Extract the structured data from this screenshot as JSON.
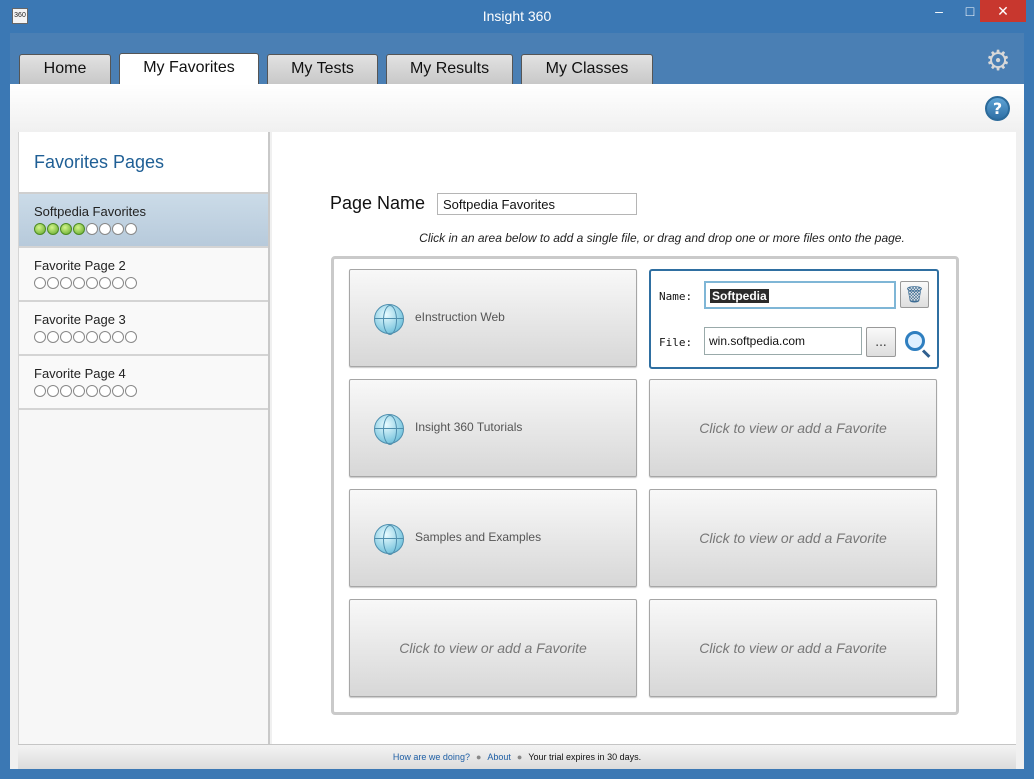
{
  "window": {
    "title": "Insight 360",
    "icon_label": "360",
    "minimize": "–",
    "maximize": "□",
    "close": "✕"
  },
  "tabs": [
    {
      "label": "Home"
    },
    {
      "label": "My Favorites",
      "active": true
    },
    {
      "label": "My Tests"
    },
    {
      "label": "My Results"
    },
    {
      "label": "My Classes"
    }
  ],
  "icons": {
    "settings": "gear-icon",
    "help": "help-icon",
    "help_glyph": "?",
    "gear_glyph": "⚙"
  },
  "sidebar": {
    "title": "Favorites Pages",
    "items": [
      {
        "label": "Softpedia Favorites",
        "filled": 4,
        "total": 8,
        "selected": true
      },
      {
        "label": "Favorite Page 2",
        "filled": 0,
        "total": 8
      },
      {
        "label": "Favorite Page 3",
        "filled": 0,
        "total": 8
      },
      {
        "label": "Favorite Page 4",
        "filled": 0,
        "total": 8
      }
    ]
  },
  "main": {
    "page_name_label": "Page Name",
    "page_name_value": "Softpedia Favorites",
    "instruction": "Click in an area below to add a single file, or drag and drop one or more files onto the page.",
    "tiles": [
      {
        "label": "eInstruction Web"
      },
      {
        "label": "Insight 360 Tutorials"
      },
      {
        "label": "Click to view or add a Favorite"
      },
      {
        "label": "Samples and Examples"
      },
      {
        "label": "Click to view or add a Favorite"
      },
      {
        "label": "Click to view or add a Favorite"
      },
      {
        "label": "Click to view or add a Favorite"
      }
    ],
    "editor": {
      "name_label": "Name:",
      "name_value": "Softpedia",
      "file_label": "File:",
      "file_value": "win.softpedia.com",
      "browse_label": "..."
    }
  },
  "status": {
    "feedback_link": "How are we doing?",
    "about_link": "About",
    "trial_text": "Your trial expires in 30 days.",
    "sep": "●"
  },
  "colors": {
    "titlebar": "#3b78b4",
    "accent": "#1f5f95",
    "close": "#c8372e",
    "dot_on": "#5ea62a"
  }
}
